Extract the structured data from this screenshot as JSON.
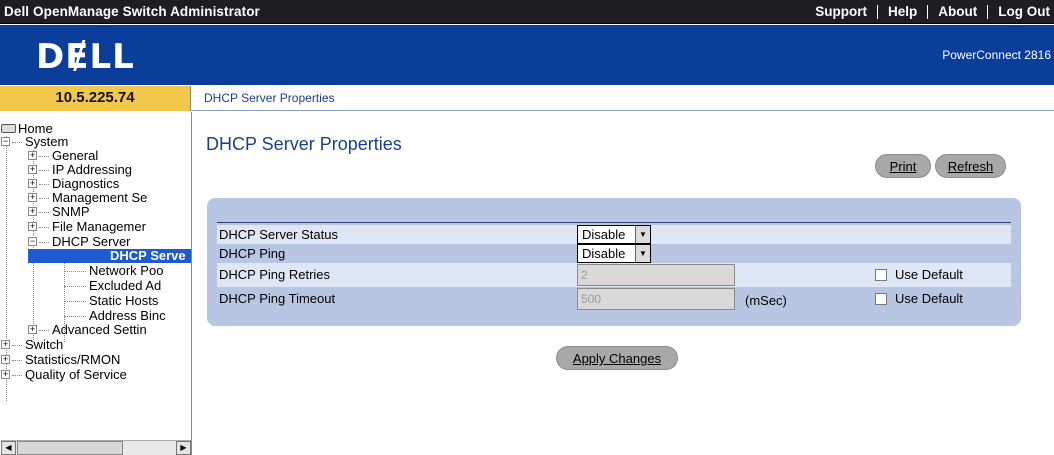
{
  "header": {
    "app_title": "Dell OpenManage Switch Administrator",
    "nav": [
      "Support",
      "Help",
      "About",
      "Log Out"
    ]
  },
  "banner": {
    "logo": "DɆLL",
    "product": "PowerConnect 2816"
  },
  "ip_address": "10.5.225.74",
  "breadcrumb": "DHCP Server Properties",
  "sidebar": {
    "home": "Home",
    "system": "System",
    "general": "General",
    "ip_addressing": "IP Addressing",
    "diagnostics": "Diagnostics",
    "management_security": "Management Se",
    "snmp": "SNMP",
    "file_management": "File Managemer",
    "dhcp_server": "DHCP Server",
    "dhcp_server_properties": "DHCP Serve",
    "network_pools": "Network Poo",
    "excluded_addresses": "Excluded Ad",
    "static_hosts": "Static Hosts",
    "address_binding": "Address Binc",
    "advanced_settings": "Advanced Settin",
    "switch": "Switch",
    "statistics": "Statistics/RMON",
    "qos": "Quality of Service"
  },
  "page": {
    "title": "DHCP Server Properties",
    "print_label": "Print",
    "refresh_label": "Refresh",
    "apply_label": "Apply Changes"
  },
  "form": {
    "status_label": "DHCP Server Status",
    "status_value": "Disable",
    "ping_label": "DHCP Ping",
    "ping_value": "Disable",
    "retries_label": "DHCP Ping Retries",
    "retries_value": "2",
    "timeout_label": "DHCP Ping Timeout",
    "timeout_value": "500",
    "timeout_unit": "(mSec)",
    "use_default_label": "Use Default"
  },
  "colors": {
    "banner": "#0a3e9a",
    "ip_cell": "#f2c84b",
    "panel": "#b9c6e3",
    "selected": "#1e5ad0",
    "title": "#1b3f8f"
  },
  "icons": [
    "home-icon",
    "expand-plus-icon",
    "collapse-minus-icon",
    "dropdown-arrow-icon",
    "scroll-left-icon",
    "scroll-right-icon"
  ]
}
